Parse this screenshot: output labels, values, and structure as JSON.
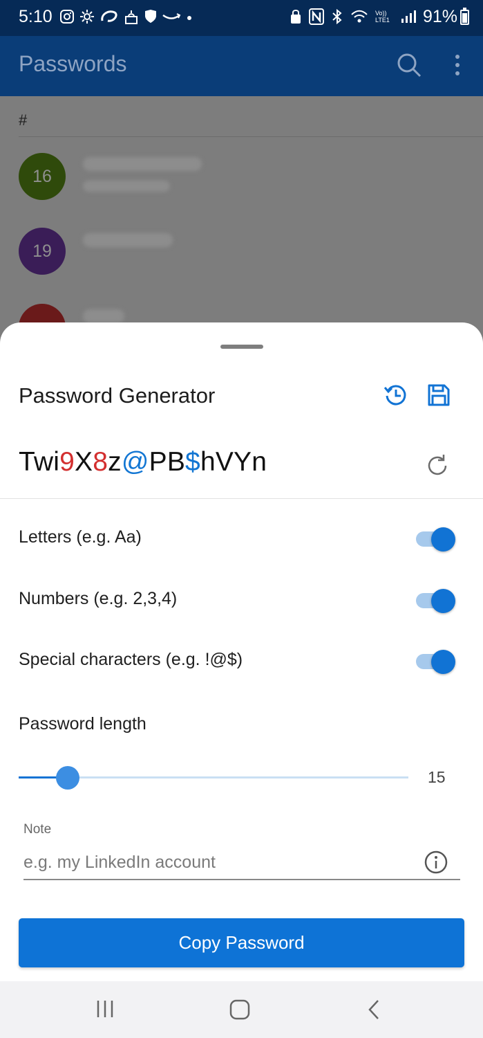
{
  "status_bar": {
    "time": "5:10",
    "battery": "91%",
    "left_icons": [
      "instagram-icon",
      "settings-gear-icon",
      "airtel-icon",
      "mosque-icon",
      "shield-icon",
      "amazon-icon",
      "dot-icon"
    ],
    "right_icons": [
      "lock-sync-icon",
      "nfc-icon",
      "bluetooth-icon",
      "wifi-icon",
      "volte-icon",
      "signal-icon"
    ],
    "volte_label": "Vo)) LTE1"
  },
  "app_bar": {
    "title": "Passwords",
    "icons": [
      "search-icon",
      "more-vert-icon"
    ]
  },
  "list": {
    "section_header": "#",
    "avatars": [
      {
        "label": "16",
        "color": "#2f4a0b"
      },
      {
        "label": "19",
        "color": "#3a1d57"
      },
      {
        "label": "",
        "color": "#6a1a1a"
      }
    ]
  },
  "generator": {
    "title": "Password Generator",
    "icons": [
      "history-icon",
      "save-icon",
      "refresh-icon"
    ],
    "password_segments": [
      {
        "text": "Twi",
        "kind": "letter"
      },
      {
        "text": "9",
        "kind": "number"
      },
      {
        "text": "X",
        "kind": "letter"
      },
      {
        "text": "8",
        "kind": "number"
      },
      {
        "text": "z",
        "kind": "letter"
      },
      {
        "text": "@",
        "kind": "symbol"
      },
      {
        "text": "PB",
        "kind": "letter"
      },
      {
        "text": "$",
        "kind": "symbol"
      },
      {
        "text": "hVYn",
        "kind": "letter"
      }
    ],
    "options": [
      {
        "label": "Letters (e.g. Aa)",
        "on": true
      },
      {
        "label": "Numbers (e.g. 2,3,4)",
        "on": true
      },
      {
        "label": "Special characters (e.g. !@$)",
        "on": true
      }
    ],
    "length": {
      "label": "Password length",
      "value": "15",
      "fraction": 0.125
    },
    "note": {
      "label": "Note",
      "placeholder": "e.g. my LinkedIn account",
      "value": ""
    },
    "copy_button": "Copy Password"
  },
  "colors": {
    "accent": "#0e73d6",
    "number_char": "#d32f2f",
    "symbol_char": "#1276d3",
    "app_bar": "#0a3d78"
  },
  "nav_bar": {
    "icons": [
      "recent-apps-icon",
      "home-icon",
      "back-icon"
    ]
  }
}
